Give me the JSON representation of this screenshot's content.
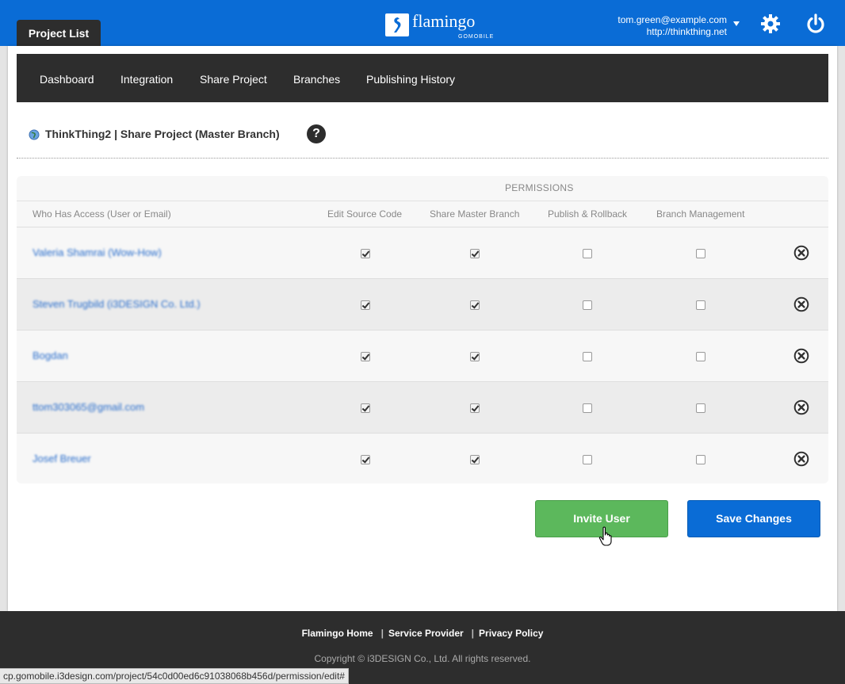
{
  "header": {
    "project_list_tab": "Project List",
    "logo_text": "flamingo",
    "logo_sub": "GOMOBILE",
    "account_email": "tom.green@example.com",
    "account_site": "http://thinkthing.net"
  },
  "subnav": {
    "items": [
      {
        "label": "Dashboard"
      },
      {
        "label": "Integration"
      },
      {
        "label": "Share Project"
      },
      {
        "label": "Branches"
      },
      {
        "label": "Publishing History"
      }
    ]
  },
  "page": {
    "title": "ThinkThing2 | Share Project (Master Branch)",
    "help": "?"
  },
  "table": {
    "permissions_label": "PERMISSIONS",
    "columns": {
      "user": "Who Has Access (User or Email)",
      "edit_source": "Edit Source Code",
      "share_master": "Share Master Branch",
      "publish": "Publish & Rollback",
      "branch_mgmt": "Branch Management"
    },
    "rows": [
      {
        "user": "Valeria Shamrai (Wow-How)",
        "edit_source": true,
        "share_master": true,
        "publish": false,
        "branch_mgmt": false
      },
      {
        "user": "Steven Trugbild (i3DESIGN Co. Ltd.)",
        "edit_source": true,
        "share_master": true,
        "publish": false,
        "branch_mgmt": false
      },
      {
        "user": "Bogdan",
        "edit_source": true,
        "share_master": true,
        "publish": false,
        "branch_mgmt": false
      },
      {
        "user": "ttom303065@gmail.com",
        "edit_source": true,
        "share_master": true,
        "publish": false,
        "branch_mgmt": false
      },
      {
        "user": "Josef Breuer",
        "edit_source": true,
        "share_master": true,
        "publish": false,
        "branch_mgmt": false
      }
    ]
  },
  "actions": {
    "invite_label": "Invite User",
    "save_label": "Save Changes"
  },
  "footer": {
    "links": [
      "Flamingo Home",
      "Service Provider",
      "Privacy Policy"
    ],
    "copyright": "Copyright © i3DESIGN Co., Ltd. All rights reserved."
  },
  "status_bar": {
    "url": "cp.gomobile.i3design.com/project/54c0d00ed6c91038068b456d/permission/edit#"
  },
  "colors": {
    "brand_blue": "#0a6cd6",
    "dark_bar": "#2d2d2d",
    "invite_green": "#5cb85c"
  }
}
